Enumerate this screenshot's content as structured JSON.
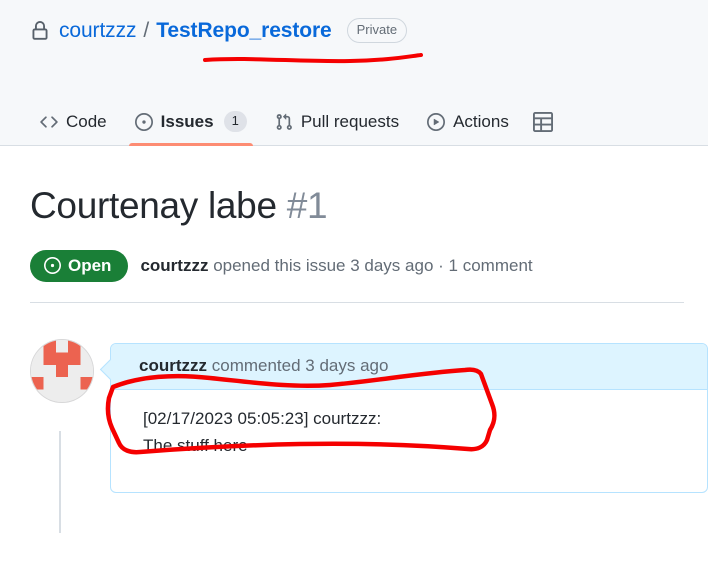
{
  "repo": {
    "lock_icon": "lock-icon",
    "owner": "courtzzz",
    "separator": "/",
    "name": "TestRepo_restore",
    "visibility_badge": "Private"
  },
  "nav": {
    "items": [
      {
        "label": "Code",
        "icon": "code-icon",
        "count": null,
        "selected": false
      },
      {
        "label": "Issues",
        "icon": "issue-opened-icon",
        "count": "1",
        "selected": true
      },
      {
        "label": "Pull requests",
        "icon": "git-pull-request-icon",
        "count": null,
        "selected": false
      },
      {
        "label": "Actions",
        "icon": "play-circle-icon",
        "count": null,
        "selected": false
      },
      {
        "label": "",
        "icon": "projects-table-icon",
        "count": null,
        "selected": false
      }
    ]
  },
  "issue": {
    "title": "Courtenay labe",
    "number": "#1",
    "state": "Open",
    "state_icon": "issue-opened-icon",
    "state_color": "#1a7f37",
    "author": "courtzzz",
    "opened_text": "opened this issue 3 days ago",
    "separator": "·",
    "comment_count": "1 comment"
  },
  "comment": {
    "avatar": "identicon-avatar",
    "author": "courtzzz",
    "action_text": "commented 3 days ago",
    "body_lines": [
      "[02/17/2023 05:05:23] courtzzz:",
      "The stuff here"
    ]
  },
  "annotations": {
    "color": "#f50000",
    "items": [
      {
        "name": "repo-name-underline",
        "shape": "wavy-line"
      },
      {
        "name": "comment-header-highlight-box",
        "shape": "hand-drawn-box"
      }
    ]
  }
}
